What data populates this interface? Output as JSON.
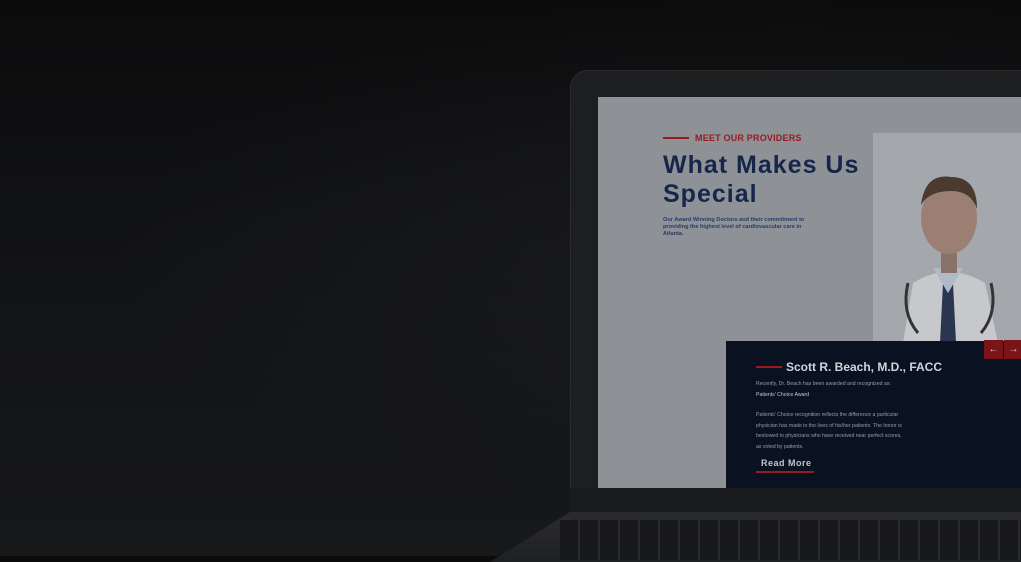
{
  "hero": {
    "eyebrow": "MEET OUR PROVIDERS",
    "headline_line1": "What Makes Us",
    "headline_line2": "Special",
    "intro": "Our Award Winning Doctors and their commitment to providing the highest level of cardiovascular care in Atlanta."
  },
  "card": {
    "name": "Scott R. Beach, M.D., FACC",
    "line1": "Recently, Dr. Beach has been awarded and recognized as:",
    "award": "Patients' Choice Award",
    "para": "Patients' Choice recognition reflects the difference a particular physician has made in the lives of his/her patients. The honor is bestowed to physicians who have received near perfect scores, as voted by patients.",
    "read_more": "Read More"
  },
  "nav": {
    "prev": "←",
    "next": "→"
  },
  "colors": {
    "navy": "#16264a",
    "accent_red": "#9a1a22",
    "card_bg": "#0a1222"
  }
}
